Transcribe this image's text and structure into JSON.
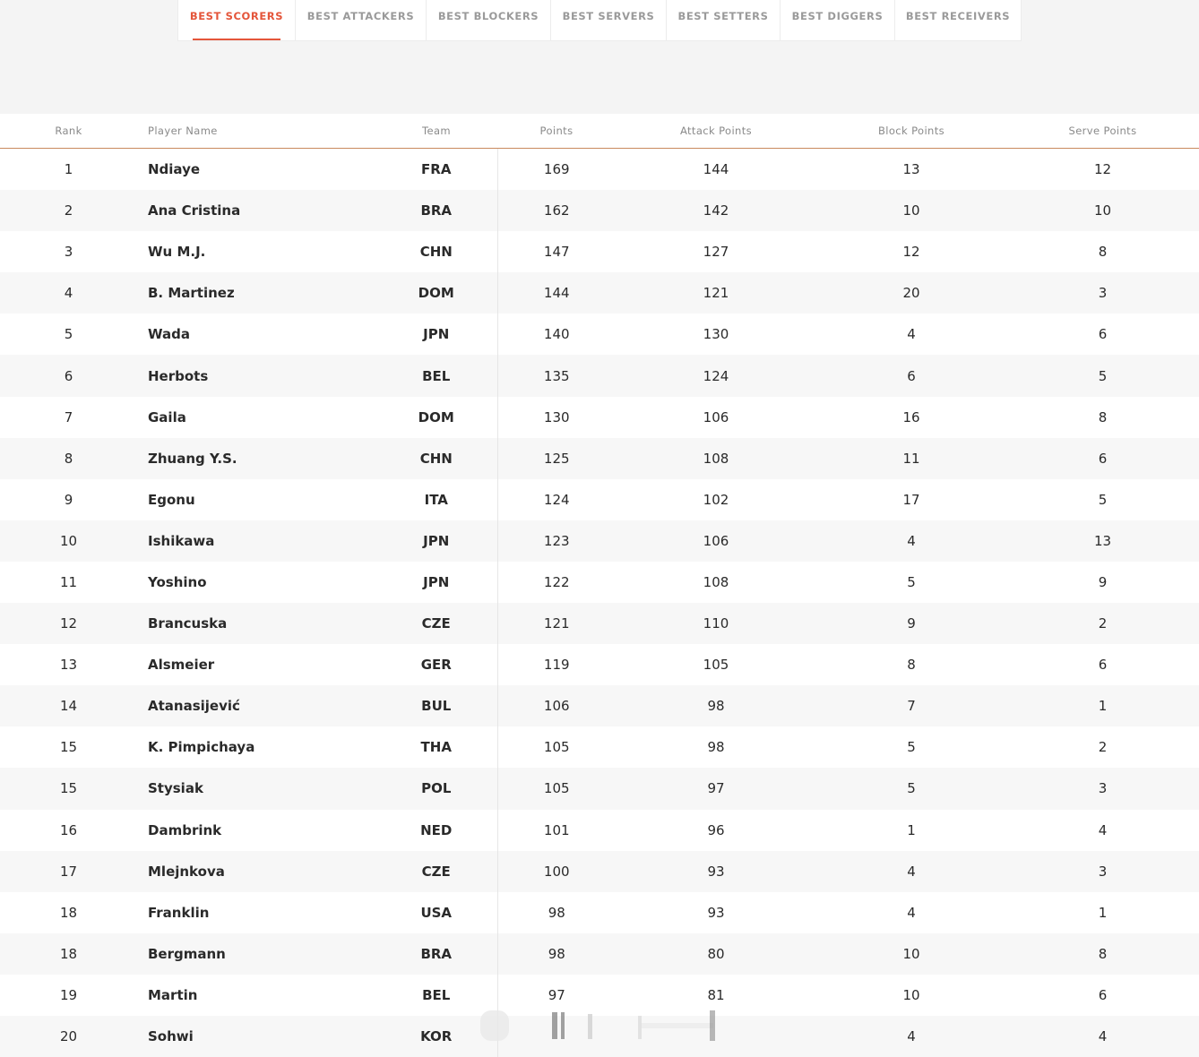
{
  "tabs": [
    {
      "label": "BEST SCORERS",
      "active": true
    },
    {
      "label": "BEST ATTACKERS",
      "active": false
    },
    {
      "label": "BEST BLOCKERS",
      "active": false
    },
    {
      "label": "BEST SERVERS",
      "active": false
    },
    {
      "label": "BEST SETTERS",
      "active": false
    },
    {
      "label": "BEST DIGGERS",
      "active": false
    },
    {
      "label": "BEST RECEIVERS",
      "active": false
    }
  ],
  "table": {
    "headers": {
      "rank": "Rank",
      "player": "Player Name",
      "team": "Team",
      "points": "Points",
      "attack": "Attack Points",
      "block": "Block Points",
      "serve": "Serve Points"
    },
    "rows": [
      {
        "rank": "1",
        "player": "Ndiaye",
        "team": "FRA",
        "points": "169",
        "attack": "144",
        "block": "13",
        "serve": "12"
      },
      {
        "rank": "2",
        "player": "Ana Cristina",
        "team": "BRA",
        "points": "162",
        "attack": "142",
        "block": "10",
        "serve": "10"
      },
      {
        "rank": "3",
        "player": "Wu M.J.",
        "team": "CHN",
        "points": "147",
        "attack": "127",
        "block": "12",
        "serve": "8"
      },
      {
        "rank": "4",
        "player": "B. Martinez",
        "team": "DOM",
        "points": "144",
        "attack": "121",
        "block": "20",
        "serve": "3"
      },
      {
        "rank": "5",
        "player": "Wada",
        "team": "JPN",
        "points": "140",
        "attack": "130",
        "block": "4",
        "serve": "6"
      },
      {
        "rank": "6",
        "player": "Herbots",
        "team": "BEL",
        "points": "135",
        "attack": "124",
        "block": "6",
        "serve": "5"
      },
      {
        "rank": "7",
        "player": "Gaila",
        "team": "DOM",
        "points": "130",
        "attack": "106",
        "block": "16",
        "serve": "8"
      },
      {
        "rank": "8",
        "player": "Zhuang Y.S.",
        "team": "CHN",
        "points": "125",
        "attack": "108",
        "block": "11",
        "serve": "6"
      },
      {
        "rank": "9",
        "player": "Egonu",
        "team": "ITA",
        "points": "124",
        "attack": "102",
        "block": "17",
        "serve": "5"
      },
      {
        "rank": "10",
        "player": "Ishikawa",
        "team": "JPN",
        "points": "123",
        "attack": "106",
        "block": "4",
        "serve": "13"
      },
      {
        "rank": "11",
        "player": "Yoshino",
        "team": "JPN",
        "points": "122",
        "attack": "108",
        "block": "5",
        "serve": "9"
      },
      {
        "rank": "12",
        "player": "Brancuska",
        "team": "CZE",
        "points": "121",
        "attack": "110",
        "block": "9",
        "serve": "2"
      },
      {
        "rank": "13",
        "player": "Alsmeier",
        "team": "GER",
        "points": "119",
        "attack": "105",
        "block": "8",
        "serve": "6"
      },
      {
        "rank": "14",
        "player": "Atanasijević",
        "team": "BUL",
        "points": "106",
        "attack": "98",
        "block": "7",
        "serve": "1"
      },
      {
        "rank": "15",
        "player": "K. Pimpichaya",
        "team": "THA",
        "points": "105",
        "attack": "98",
        "block": "5",
        "serve": "2"
      },
      {
        "rank": "15",
        "player": "Stysiak",
        "team": "POL",
        "points": "105",
        "attack": "97",
        "block": "5",
        "serve": "3"
      },
      {
        "rank": "16",
        "player": "Dambrink",
        "team": "NED",
        "points": "101",
        "attack": "96",
        "block": "1",
        "serve": "4"
      },
      {
        "rank": "17",
        "player": "Mlejnkova",
        "team": "CZE",
        "points": "100",
        "attack": "93",
        "block": "4",
        "serve": "3"
      },
      {
        "rank": "18",
        "player": "Franklin",
        "team": "USA",
        "points": "98",
        "attack": "93",
        "block": "4",
        "serve": "1"
      },
      {
        "rank": "18",
        "player": "Bergmann",
        "team": "BRA",
        "points": "98",
        "attack": "80",
        "block": "10",
        "serve": "8"
      },
      {
        "rank": "19",
        "player": "Martin",
        "team": "BEL",
        "points": "97",
        "attack": "81",
        "block": "10",
        "serve": "6"
      },
      {
        "rank": "20",
        "player": "Sohwi",
        "team": "KOR",
        "points": "",
        "attack": "",
        "block": "4",
        "serve": "4"
      }
    ]
  }
}
